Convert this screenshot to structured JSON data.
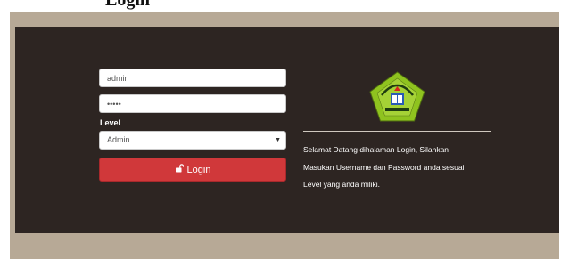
{
  "header": {
    "title": "Login"
  },
  "form": {
    "username_value": "admin",
    "password_value": "•••••",
    "level_label": "Level",
    "level_selected": "Admin",
    "login_label": "Login"
  },
  "welcome": {
    "lines": [
      "Selamat Datang dihalaman Login, Silahkan",
      "Masukan Username dan Password anda sesuai",
      "Level yang anda miliki."
    ]
  },
  "colors": {
    "panel_background": "#2d2522",
    "frame_background": "#b7a996",
    "login_button": "#d0383a",
    "logo_green": "#8fc31f"
  },
  "icons": {
    "lock": "unlock-icon",
    "dropdown": "chevron-down-icon",
    "logo": "school-logo"
  }
}
